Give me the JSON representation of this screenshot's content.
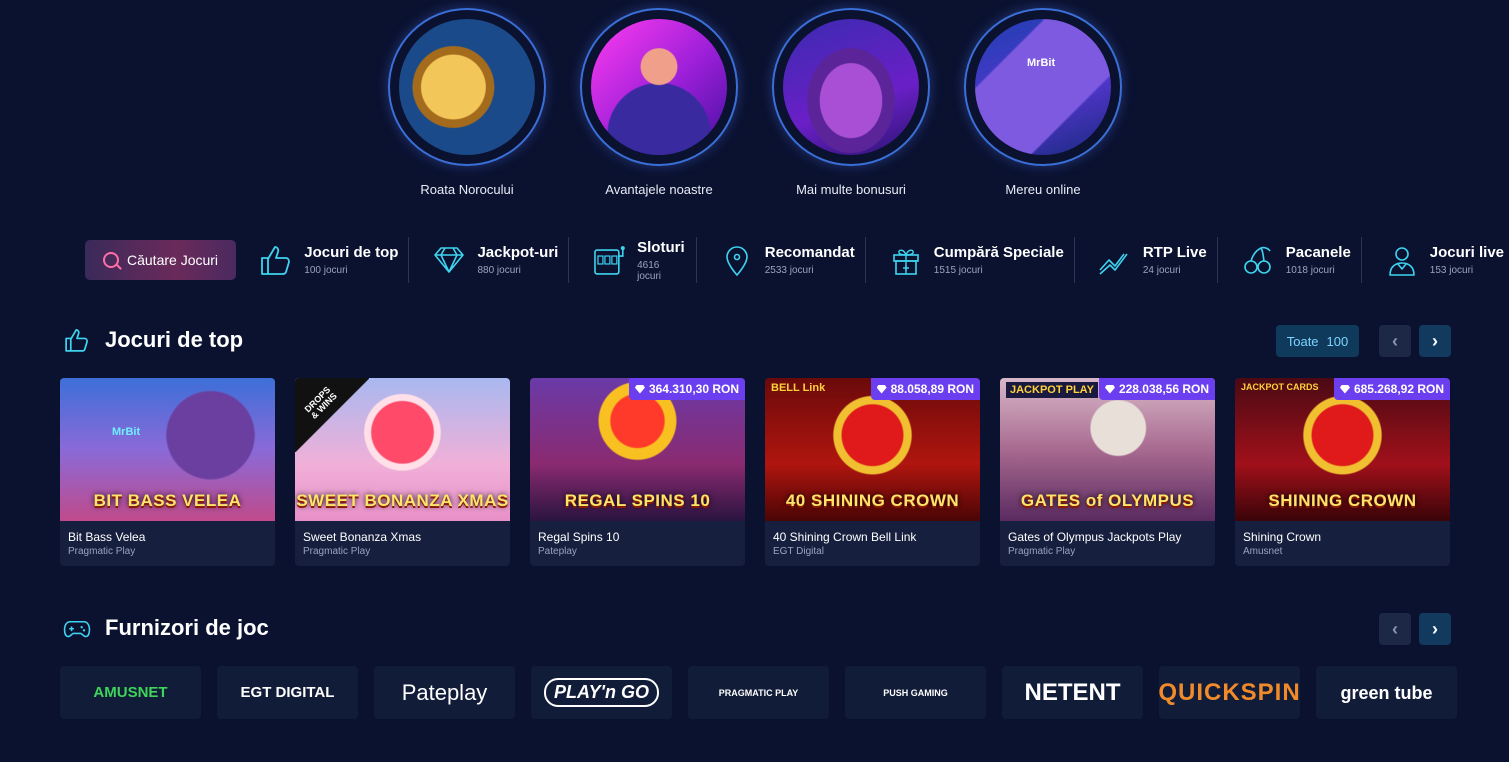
{
  "promos": [
    {
      "label": "Roata Norocului",
      "icon": "wheel-icon"
    },
    {
      "label": "Avantajele noastre",
      "icon": "person-icon"
    },
    {
      "label": "Mai multe bonusuri",
      "icon": "chest-icon"
    },
    {
      "label": "Mereu online",
      "icon": "phone-icon",
      "brand": "MrBit"
    }
  ],
  "search": {
    "label": "Căutare Jocuri"
  },
  "categories": [
    {
      "title": "Jocuri de top",
      "count": "100 jocuri",
      "icon": "thumbs-up-icon"
    },
    {
      "title": "Jackpot-uri",
      "count": "880 jocuri",
      "icon": "diamond-icon"
    },
    {
      "title": "Sloturi",
      "count": "4616 jocuri",
      "icon": "slot-machine-icon"
    },
    {
      "title": "Recomandat",
      "count": "2533 jocuri",
      "icon": "location-pin-icon"
    },
    {
      "title": "Cumpără Speciale",
      "count": "1515 jocuri",
      "icon": "gift-icon"
    },
    {
      "title": "RTP Live",
      "count": "24 jocuri",
      "icon": "trend-icon"
    },
    {
      "title": "Pacanele",
      "count": "1018 jocuri",
      "icon": "cherry-icon"
    },
    {
      "title": "Jocuri live",
      "count": "153 jocuri",
      "icon": "dealer-icon"
    }
  ],
  "top_section": {
    "title": "Jocuri de top",
    "all_label": "Toate",
    "all_count": "100"
  },
  "games": [
    {
      "name": "Bit Bass Velea",
      "provider": "Pragmatic Play",
      "art": "BIT BASS VELEA",
      "logo": "MrBit",
      "jackpot": ""
    },
    {
      "name": "Sweet Bonanza Xmas",
      "provider": "Pragmatic Play",
      "art": "SWEET BONANZA XMAS",
      "badge": "DROPS & WINS",
      "jackpot": ""
    },
    {
      "name": "Regal Spins 10",
      "provider": "Pateplay",
      "art": "REGAL SPINS 10",
      "jackpot": "364.310,30 RON"
    },
    {
      "name": "40 Shining Crown Bell Link",
      "provider": "EGT Digital",
      "art": "40 SHINING CROWN",
      "logo": "BELL Link",
      "jackpot": "88.058,89 RON"
    },
    {
      "name": "Gates of Olympus Jackpots Play",
      "provider": "Pragmatic Play",
      "art": "GATES of OLYMPUS",
      "logo": "JACKPOT PLAY",
      "jackpot": "228.038,56 RON"
    },
    {
      "name": "Shining Crown",
      "provider": "Amusnet",
      "art": "SHINING CROWN",
      "logo": "JACKPOT CARDS",
      "jackpot": "685.268,92 RON"
    }
  ],
  "providers_section": {
    "title": "Furnizori de joc"
  },
  "providers": [
    {
      "name": "AMUSNET"
    },
    {
      "name": "EGT DIGITAL"
    },
    {
      "name": "Pateplay"
    },
    {
      "name": "PLAY'n GO"
    },
    {
      "name": "PRAGMATIC PLAY"
    },
    {
      "name": "PUSH GAMING"
    },
    {
      "name": "NETENT"
    },
    {
      "name": "QUICKSPIN"
    },
    {
      "name": "green tube"
    }
  ],
  "colors": {
    "background": "#0b1230",
    "accent": "#3ed4f0",
    "jackpot": "#6b3ff0"
  }
}
